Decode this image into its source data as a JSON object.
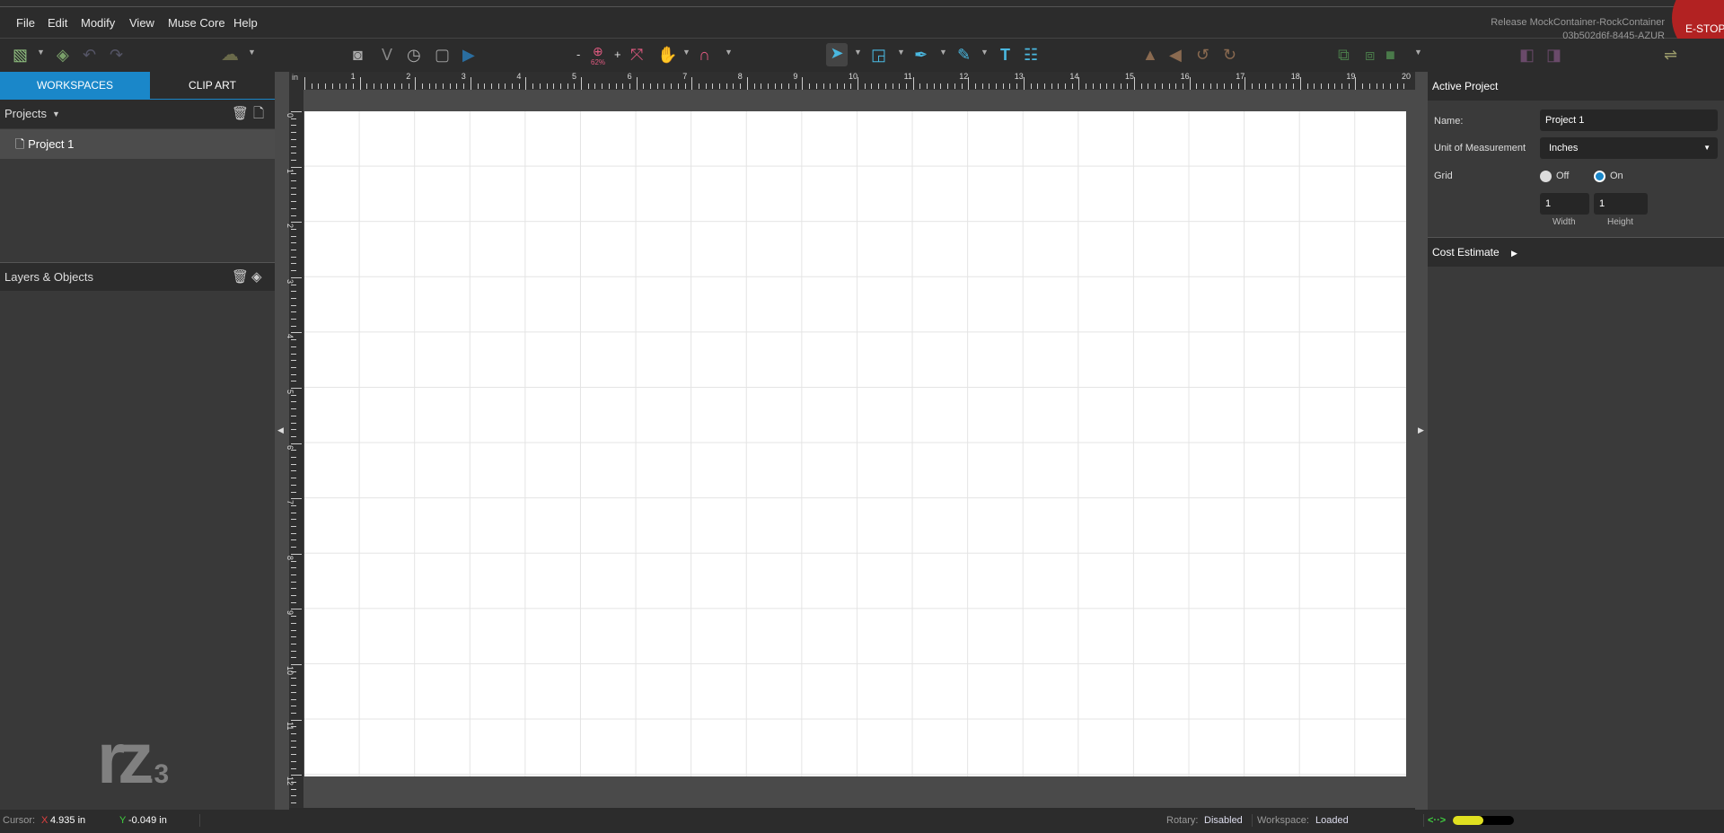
{
  "menu": [
    "File",
    "Edit",
    "Modify",
    "View",
    "Muse Core",
    "Help"
  ],
  "release": {
    "line1": "Release MockContainer-RockContainer",
    "line2": "03b502d6f-8445-AZUR"
  },
  "estop": "E-STOP",
  "toolbar": {
    "zoom_minus": "-",
    "zoom_plus": "+",
    "zoom_level": "62%"
  },
  "left_tabs": [
    "WORKSPACES",
    "CLIP ART"
  ],
  "projects": {
    "title": "Projects",
    "items": [
      "Project 1"
    ]
  },
  "layers": {
    "title": "Layers & Objects"
  },
  "logo": "rz.3",
  "ruler": {
    "unit": "in",
    "h_ticks": [
      "1",
      "2",
      "3",
      "4",
      "5",
      "6",
      "7",
      "8",
      "9",
      "10",
      "11",
      "12",
      "13",
      "14",
      "15",
      "16",
      "17",
      "18",
      "19",
      "20"
    ],
    "v_ticks": [
      "0",
      "1",
      "2",
      "3",
      "4",
      "5",
      "6",
      "7",
      "8",
      "9",
      "10",
      "11",
      "12"
    ]
  },
  "right": {
    "title": "Active Project",
    "name_label": "Name:",
    "name_value": "Project 1",
    "unit_label": "Unit of Measurement",
    "unit_value": "Inches",
    "grid_label": "Grid",
    "grid_off": "Off",
    "grid_on": "On",
    "grid_selected": "On",
    "width_value": "1",
    "height_value": "1",
    "width_label": "Width",
    "height_label": "Height",
    "cost_label": "Cost Estimate"
  },
  "status": {
    "cursor_label": "Cursor:",
    "x_label": "X",
    "x_value": "4.935 in",
    "y_label": "Y",
    "y_value": "-0.049 in",
    "rotary_label": "Rotary:",
    "rotary_value": "Disabled",
    "workspace_label": "Workspace:",
    "workspace_value": "Loaded",
    "connection_level": 0.5
  },
  "colors": {
    "accent": "#1a87c9",
    "estop": "#b22222",
    "x": "#e04040",
    "y": "#40d040",
    "progress": "#e0e020"
  }
}
